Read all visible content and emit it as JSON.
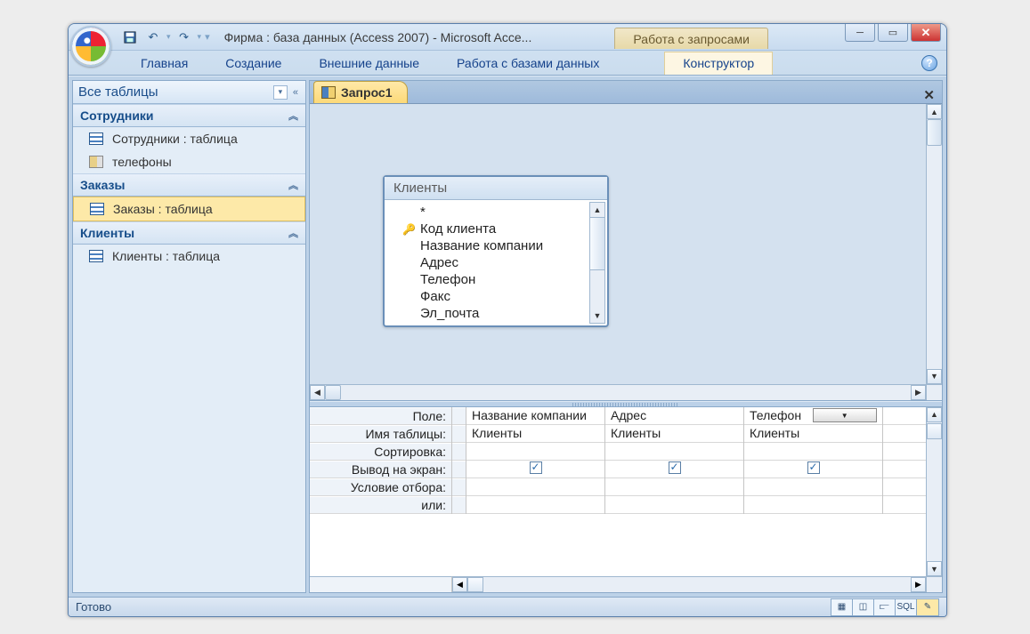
{
  "window": {
    "title": "Фирма : база данных (Access 2007) - Microsoft Acce...",
    "context_tools_title": "Работа с запросами"
  },
  "ribbon": {
    "tabs": [
      "Главная",
      "Создание",
      "Внешние данные",
      "Работа с базами данных"
    ],
    "context_tab": "Конструктор"
  },
  "nav": {
    "title": "Все таблицы",
    "groups": [
      {
        "name": "Сотрудники",
        "items": [
          {
            "type": "table",
            "label": "Сотрудники : таблица"
          },
          {
            "type": "query",
            "label": "телефоны"
          }
        ]
      },
      {
        "name": "Заказы",
        "items": [
          {
            "type": "table",
            "label": "Заказы : таблица",
            "selected": true
          }
        ]
      },
      {
        "name": "Клиенты",
        "items": [
          {
            "type": "table",
            "label": "Клиенты : таблица"
          }
        ]
      }
    ]
  },
  "document": {
    "tab_title": "Запрос1",
    "field_list": {
      "title": "Клиенты",
      "fields": [
        "*",
        "Код клиента",
        "Название компании",
        "Адрес",
        "Телефон",
        "Факс",
        "Эл_почта"
      ],
      "key_field_index": 1
    },
    "qbe": {
      "row_labels": [
        "Поле:",
        "Имя таблицы:",
        "Сортировка:",
        "Вывод на экран:",
        "Условие отбора:",
        "или:"
      ],
      "columns": [
        {
          "field": "Название компании",
          "table": "Клиенты",
          "sort": "",
          "show": true,
          "criteria": "",
          "or": ""
        },
        {
          "field": "Адрес",
          "table": "Клиенты",
          "sort": "",
          "show": true,
          "criteria": "",
          "or": ""
        },
        {
          "field": "Телефон",
          "table": "Клиенты",
          "sort": "",
          "show": true,
          "criteria": "",
          "or": "",
          "dropdown": true
        }
      ]
    }
  },
  "status": {
    "text": "Готово",
    "view_buttons": [
      "datasheet-icon",
      "pivot-table-icon",
      "pivot-chart-icon",
      "SQL",
      "design-icon"
    ]
  }
}
